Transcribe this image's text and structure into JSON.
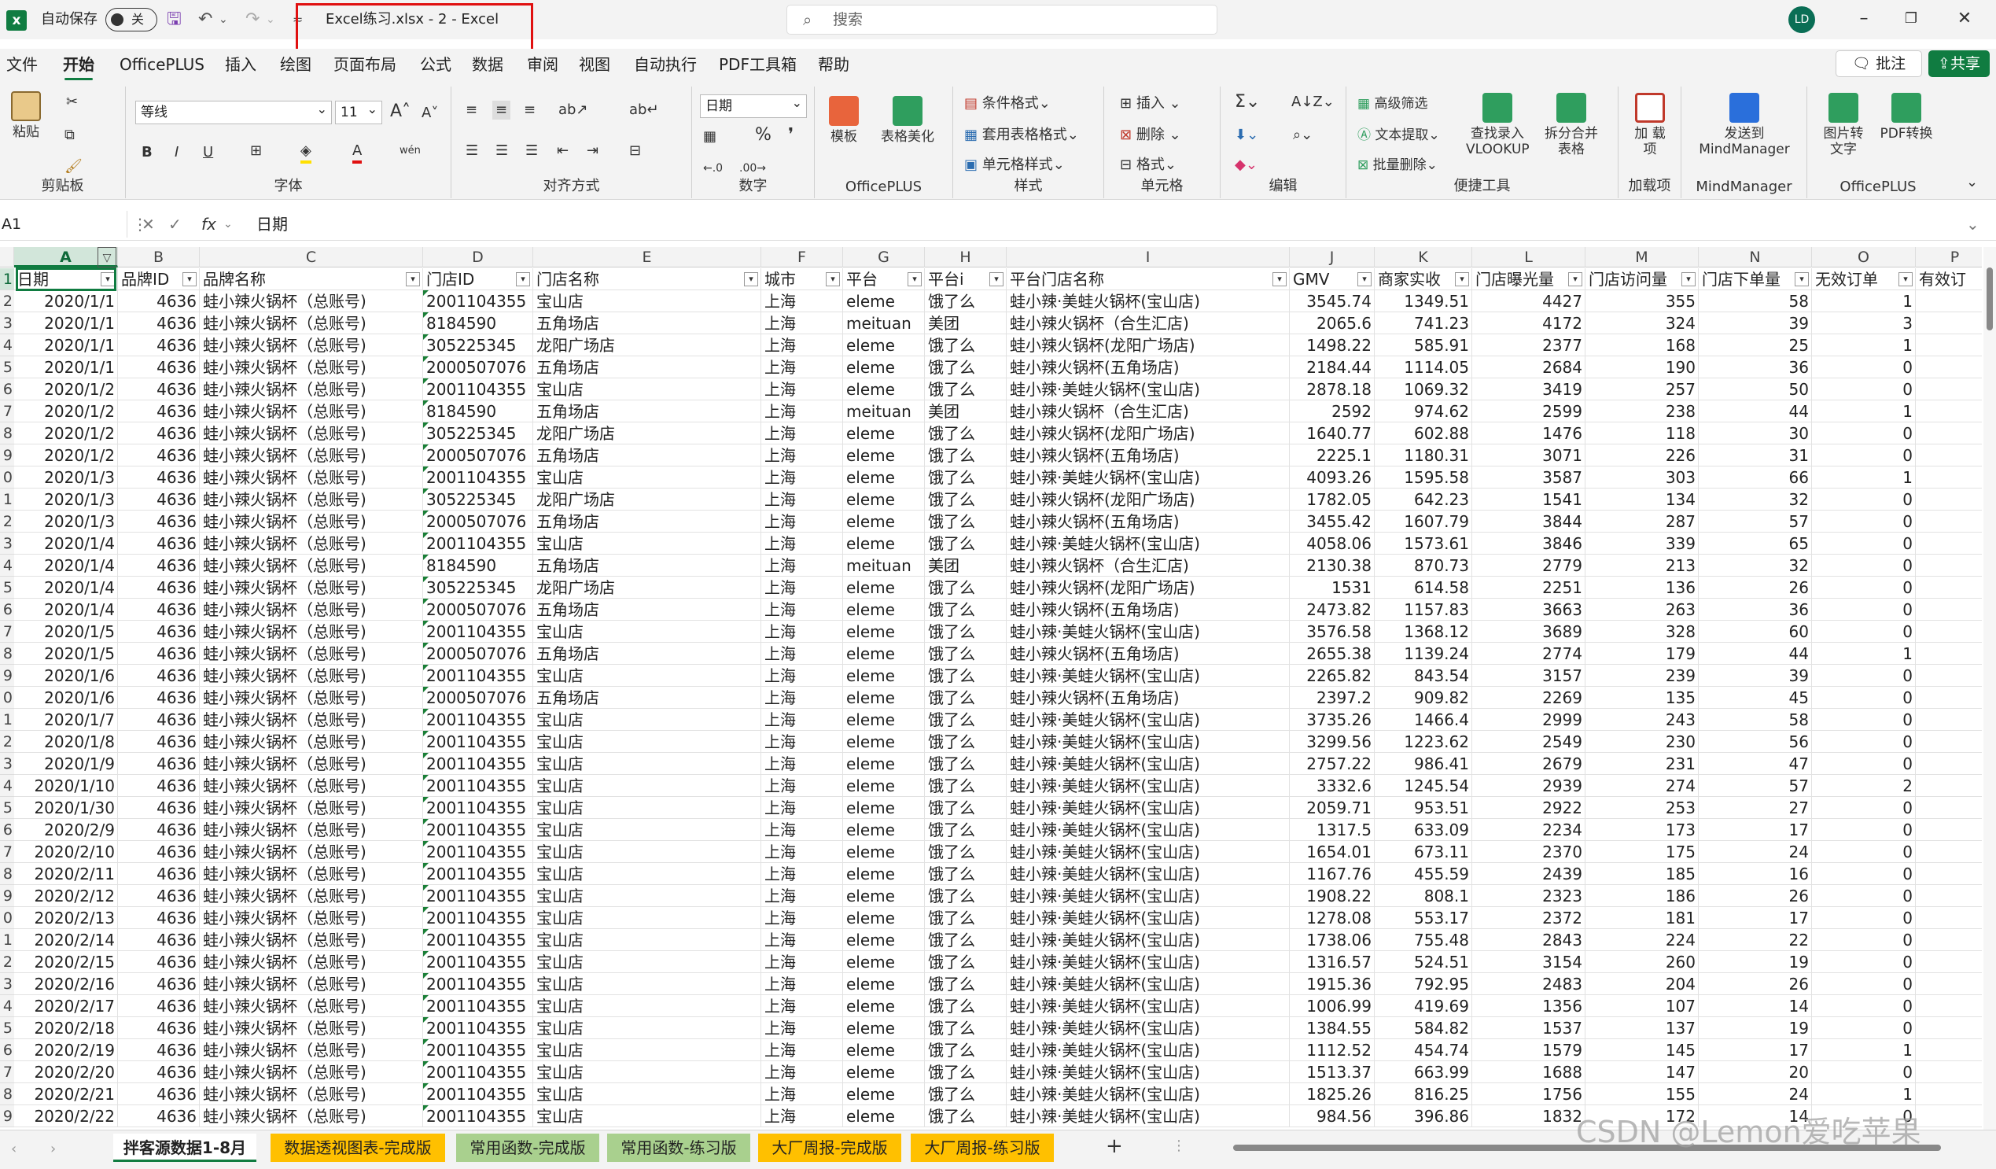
{
  "titlebar": {
    "autosave_label": "自动保存",
    "autosave_state": "关",
    "doc_title": "Excel练习.xlsx  -  2  -  Excel",
    "search_placeholder": "搜索",
    "avatar": "LD"
  },
  "menu": {
    "tabs": [
      "文件",
      "开始",
      "OfficePLUS",
      "插入",
      "绘图",
      "页面布局",
      "公式",
      "数据",
      "审阅",
      "视图",
      "自动执行",
      "PDF工具箱",
      "帮助"
    ],
    "active": "开始",
    "comment_btn": "批注",
    "share_btn": "共享"
  },
  "ribbon": {
    "clipboard": {
      "label": "剪贴板",
      "paste": "粘贴"
    },
    "font": {
      "label": "字体",
      "name": "等线",
      "size": "11"
    },
    "align": {
      "label": "对齐方式"
    },
    "number": {
      "label": "数字",
      "format": "日期"
    },
    "officeplus": {
      "label": "OfficePLUS",
      "template": "模板",
      "beautify": "表格美化"
    },
    "styles": {
      "label": "样式",
      "cond": "条件格式",
      "table": "套用表格格式",
      "cell": "单元格样式"
    },
    "cells": {
      "label": "单元格",
      "insert": "插入",
      "delete": "删除",
      "format": "格式"
    },
    "edit": {
      "label": "编辑"
    },
    "convenience": {
      "label": "便捷工具",
      "adv_filter": "高级筛选",
      "text_extract": "文本提取",
      "batch_delete": "批量删除",
      "lookup": "查找录入 VLOOKUP",
      "split": "拆分合并 表格"
    },
    "addins": {
      "label": "加载项",
      "btn": "加 载项"
    },
    "mindmanager": {
      "label": "MindManager",
      "btn": "发送到 MindManager"
    },
    "officeplus2": {
      "label": "OfficePLUS",
      "img2text": "图片转 文字",
      "pdf": "PDF转换"
    }
  },
  "formula_bar": {
    "name_box": "A1",
    "fx": "fx",
    "content": "日期"
  },
  "grid": {
    "col_letters": [
      "A",
      "B",
      "C",
      "D",
      "E",
      "F",
      "G",
      "H",
      "I",
      "J",
      "K",
      "L",
      "M",
      "N",
      "O",
      "P"
    ],
    "row_numbers": [
      "1",
      "2",
      "3",
      "4",
      "5",
      "6",
      "7",
      "8",
      "9",
      "0",
      "1",
      "2",
      "3",
      "4",
      "5",
      "6",
      "7",
      "8",
      "9",
      "0",
      "1",
      "2",
      "3",
      "4",
      "5",
      "6",
      "7",
      "8",
      "9",
      "0",
      "1",
      "2",
      "3",
      "4",
      "5",
      "6",
      "7",
      "8",
      "9"
    ],
    "headers": [
      "日期",
      "品牌ID",
      "品牌名称",
      "门店ID",
      "门店名称",
      "城市",
      "平台",
      "平台i",
      "平台门店名称",
      "GMV",
      "商家实收",
      "门店曝光量",
      "门店访问量",
      "门店下单量",
      "无效订单",
      "有效订"
    ],
    "rows": [
      [
        "2020/1/1",
        "4636",
        "蛙小辣火锅杯（总账号)",
        "2001104355",
        "宝山店",
        "上海",
        "eleme",
        "饿了么",
        "蛙小辣·美蛙火锅杯(宝山店)",
        "3545.74",
        "1349.51",
        "4427",
        "355",
        "58",
        "1"
      ],
      [
        "2020/1/1",
        "4636",
        "蛙小辣火锅杯（总账号)",
        "8184590",
        "五角场店",
        "上海",
        "meituan",
        "美团",
        "蛙小辣火锅杯（合生汇店)",
        "2065.6",
        "741.23",
        "4172",
        "324",
        "39",
        "3"
      ],
      [
        "2020/1/1",
        "4636",
        "蛙小辣火锅杯（总账号)",
        "305225345",
        "龙阳广场店",
        "上海",
        "eleme",
        "饿了么",
        "蛙小辣火锅杯(龙阳广场店)",
        "1498.22",
        "585.91",
        "2377",
        "168",
        "25",
        "1"
      ],
      [
        "2020/1/1",
        "4636",
        "蛙小辣火锅杯（总账号)",
        "2000507076",
        "五角场店",
        "上海",
        "eleme",
        "饿了么",
        "蛙小辣火锅杯(五角场店)",
        "2184.44",
        "1114.05",
        "2684",
        "190",
        "36",
        "0"
      ],
      [
        "2020/1/2",
        "4636",
        "蛙小辣火锅杯（总账号)",
        "2001104355",
        "宝山店",
        "上海",
        "eleme",
        "饿了么",
        "蛙小辣·美蛙火锅杯(宝山店)",
        "2878.18",
        "1069.32",
        "3419",
        "257",
        "50",
        "0"
      ],
      [
        "2020/1/2",
        "4636",
        "蛙小辣火锅杯（总账号)",
        "8184590",
        "五角场店",
        "上海",
        "meituan",
        "美团",
        "蛙小辣火锅杯（合生汇店)",
        "2592",
        "974.62",
        "2599",
        "238",
        "44",
        "1"
      ],
      [
        "2020/1/2",
        "4636",
        "蛙小辣火锅杯（总账号)",
        "305225345",
        "龙阳广场店",
        "上海",
        "eleme",
        "饿了么",
        "蛙小辣火锅杯(龙阳广场店)",
        "1640.77",
        "602.88",
        "1476",
        "118",
        "30",
        "0"
      ],
      [
        "2020/1/2",
        "4636",
        "蛙小辣火锅杯（总账号)",
        "2000507076",
        "五角场店",
        "上海",
        "eleme",
        "饿了么",
        "蛙小辣火锅杯(五角场店)",
        "2225.1",
        "1180.31",
        "3071",
        "226",
        "31",
        "0"
      ],
      [
        "2020/1/3",
        "4636",
        "蛙小辣火锅杯（总账号)",
        "2001104355",
        "宝山店",
        "上海",
        "eleme",
        "饿了么",
        "蛙小辣·美蛙火锅杯(宝山店)",
        "4093.26",
        "1595.58",
        "3587",
        "303",
        "66",
        "1"
      ],
      [
        "2020/1/3",
        "4636",
        "蛙小辣火锅杯（总账号)",
        "305225345",
        "龙阳广场店",
        "上海",
        "eleme",
        "饿了么",
        "蛙小辣火锅杯(龙阳广场店)",
        "1782.05",
        "642.23",
        "1541",
        "134",
        "32",
        "0"
      ],
      [
        "2020/1/3",
        "4636",
        "蛙小辣火锅杯（总账号)",
        "2000507076",
        "五角场店",
        "上海",
        "eleme",
        "饿了么",
        "蛙小辣火锅杯(五角场店)",
        "3455.42",
        "1607.79",
        "3844",
        "287",
        "57",
        "0"
      ],
      [
        "2020/1/4",
        "4636",
        "蛙小辣火锅杯（总账号)",
        "2001104355",
        "宝山店",
        "上海",
        "eleme",
        "饿了么",
        "蛙小辣·美蛙火锅杯(宝山店)",
        "4058.06",
        "1573.61",
        "3846",
        "339",
        "65",
        "0"
      ],
      [
        "2020/1/4",
        "4636",
        "蛙小辣火锅杯（总账号)",
        "8184590",
        "五角场店",
        "上海",
        "meituan",
        "美团",
        "蛙小辣火锅杯（合生汇店)",
        "2130.38",
        "870.73",
        "2779",
        "213",
        "32",
        "0"
      ],
      [
        "2020/1/4",
        "4636",
        "蛙小辣火锅杯（总账号)",
        "305225345",
        "龙阳广场店",
        "上海",
        "eleme",
        "饿了么",
        "蛙小辣火锅杯(龙阳广场店)",
        "1531",
        "614.58",
        "2251",
        "136",
        "26",
        "0"
      ],
      [
        "2020/1/4",
        "4636",
        "蛙小辣火锅杯（总账号)",
        "2000507076",
        "五角场店",
        "上海",
        "eleme",
        "饿了么",
        "蛙小辣火锅杯(五角场店)",
        "2473.82",
        "1157.83",
        "3663",
        "263",
        "36",
        "0"
      ],
      [
        "2020/1/5",
        "4636",
        "蛙小辣火锅杯（总账号)",
        "2001104355",
        "宝山店",
        "上海",
        "eleme",
        "饿了么",
        "蛙小辣·美蛙火锅杯(宝山店)",
        "3576.58",
        "1368.12",
        "3689",
        "328",
        "60",
        "0"
      ],
      [
        "2020/1/5",
        "4636",
        "蛙小辣火锅杯（总账号)",
        "2000507076",
        "五角场店",
        "上海",
        "eleme",
        "饿了么",
        "蛙小辣火锅杯(五角场店)",
        "2655.38",
        "1139.24",
        "2774",
        "179",
        "44",
        "1"
      ],
      [
        "2020/1/6",
        "4636",
        "蛙小辣火锅杯（总账号)",
        "2001104355",
        "宝山店",
        "上海",
        "eleme",
        "饿了么",
        "蛙小辣·美蛙火锅杯(宝山店)",
        "2265.82",
        "843.54",
        "3157",
        "239",
        "39",
        "0"
      ],
      [
        "2020/1/6",
        "4636",
        "蛙小辣火锅杯（总账号)",
        "2000507076",
        "五角场店",
        "上海",
        "eleme",
        "饿了么",
        "蛙小辣火锅杯(五角场店)",
        "2397.2",
        "909.82",
        "2269",
        "135",
        "45",
        "0"
      ],
      [
        "2020/1/7",
        "4636",
        "蛙小辣火锅杯（总账号)",
        "2001104355",
        "宝山店",
        "上海",
        "eleme",
        "饿了么",
        "蛙小辣·美蛙火锅杯(宝山店)",
        "3735.26",
        "1466.4",
        "2999",
        "243",
        "58",
        "0"
      ],
      [
        "2020/1/8",
        "4636",
        "蛙小辣火锅杯（总账号)",
        "2001104355",
        "宝山店",
        "上海",
        "eleme",
        "饿了么",
        "蛙小辣·美蛙火锅杯(宝山店)",
        "3299.56",
        "1223.62",
        "2549",
        "230",
        "56",
        "0"
      ],
      [
        "2020/1/9",
        "4636",
        "蛙小辣火锅杯（总账号)",
        "2001104355",
        "宝山店",
        "上海",
        "eleme",
        "饿了么",
        "蛙小辣·美蛙火锅杯(宝山店)",
        "2757.22",
        "986.41",
        "2679",
        "231",
        "47",
        "0"
      ],
      [
        "2020/1/10",
        "4636",
        "蛙小辣火锅杯（总账号)",
        "2001104355",
        "宝山店",
        "上海",
        "eleme",
        "饿了么",
        "蛙小辣·美蛙火锅杯(宝山店)",
        "3332.6",
        "1245.54",
        "2939",
        "274",
        "57",
        "2"
      ],
      [
        "2020/1/30",
        "4636",
        "蛙小辣火锅杯（总账号)",
        "2001104355",
        "宝山店",
        "上海",
        "eleme",
        "饿了么",
        "蛙小辣·美蛙火锅杯(宝山店)",
        "2059.71",
        "953.51",
        "2922",
        "253",
        "27",
        "0"
      ],
      [
        "2020/2/9",
        "4636",
        "蛙小辣火锅杯（总账号)",
        "2001104355",
        "宝山店",
        "上海",
        "eleme",
        "饿了么",
        "蛙小辣·美蛙火锅杯(宝山店)",
        "1317.5",
        "633.09",
        "2234",
        "173",
        "17",
        "0"
      ],
      [
        "2020/2/10",
        "4636",
        "蛙小辣火锅杯（总账号)",
        "2001104355",
        "宝山店",
        "上海",
        "eleme",
        "饿了么",
        "蛙小辣·美蛙火锅杯(宝山店)",
        "1654.01",
        "673.11",
        "2370",
        "175",
        "24",
        "0"
      ],
      [
        "2020/2/11",
        "4636",
        "蛙小辣火锅杯（总账号)",
        "2001104355",
        "宝山店",
        "上海",
        "eleme",
        "饿了么",
        "蛙小辣·美蛙火锅杯(宝山店)",
        "1167.76",
        "455.59",
        "2439",
        "185",
        "16",
        "0"
      ],
      [
        "2020/2/12",
        "4636",
        "蛙小辣火锅杯（总账号)",
        "2001104355",
        "宝山店",
        "上海",
        "eleme",
        "饿了么",
        "蛙小辣·美蛙火锅杯(宝山店)",
        "1908.22",
        "808.1",
        "2323",
        "186",
        "26",
        "0"
      ],
      [
        "2020/2/13",
        "4636",
        "蛙小辣火锅杯（总账号)",
        "2001104355",
        "宝山店",
        "上海",
        "eleme",
        "饿了么",
        "蛙小辣·美蛙火锅杯(宝山店)",
        "1278.08",
        "553.17",
        "2372",
        "181",
        "17",
        "0"
      ],
      [
        "2020/2/14",
        "4636",
        "蛙小辣火锅杯（总账号)",
        "2001104355",
        "宝山店",
        "上海",
        "eleme",
        "饿了么",
        "蛙小辣·美蛙火锅杯(宝山店)",
        "1738.06",
        "755.48",
        "2843",
        "224",
        "22",
        "0"
      ],
      [
        "2020/2/15",
        "4636",
        "蛙小辣火锅杯（总账号)",
        "2001104355",
        "宝山店",
        "上海",
        "eleme",
        "饿了么",
        "蛙小辣·美蛙火锅杯(宝山店)",
        "1316.57",
        "524.51",
        "3154",
        "260",
        "19",
        "0"
      ],
      [
        "2020/2/16",
        "4636",
        "蛙小辣火锅杯（总账号)",
        "2001104355",
        "宝山店",
        "上海",
        "eleme",
        "饿了么",
        "蛙小辣·美蛙火锅杯(宝山店)",
        "1915.36",
        "792.95",
        "2483",
        "204",
        "26",
        "0"
      ],
      [
        "2020/2/17",
        "4636",
        "蛙小辣火锅杯（总账号)",
        "2001104355",
        "宝山店",
        "上海",
        "eleme",
        "饿了么",
        "蛙小辣·美蛙火锅杯(宝山店)",
        "1006.99",
        "419.69",
        "1356",
        "107",
        "14",
        "0"
      ],
      [
        "2020/2/18",
        "4636",
        "蛙小辣火锅杯（总账号)",
        "2001104355",
        "宝山店",
        "上海",
        "eleme",
        "饿了么",
        "蛙小辣·美蛙火锅杯(宝山店)",
        "1384.55",
        "584.82",
        "1537",
        "137",
        "19",
        "0"
      ],
      [
        "2020/2/19",
        "4636",
        "蛙小辣火锅杯（总账号)",
        "2001104355",
        "宝山店",
        "上海",
        "eleme",
        "饿了么",
        "蛙小辣·美蛙火锅杯(宝山店)",
        "1112.52",
        "454.74",
        "1579",
        "145",
        "17",
        "1"
      ],
      [
        "2020/2/20",
        "4636",
        "蛙小辣火锅杯（总账号)",
        "2001104355",
        "宝山店",
        "上海",
        "eleme",
        "饿了么",
        "蛙小辣·美蛙火锅杯(宝山店)",
        "1513.37",
        "663.99",
        "1688",
        "147",
        "20",
        "0"
      ],
      [
        "2020/2/21",
        "4636",
        "蛙小辣火锅杯（总账号)",
        "2001104355",
        "宝山店",
        "上海",
        "eleme",
        "饿了么",
        "蛙小辣·美蛙火锅杯(宝山店)",
        "1825.26",
        "816.25",
        "1756",
        "155",
        "24",
        "1"
      ],
      [
        "2020/2/22",
        "4636",
        "蛙小辣火锅杯（总账号)",
        "2001104355",
        "宝山店",
        "上海",
        "eleme",
        "饿了么",
        "蛙小辣·美蛙火锅杯(宝山店)",
        "984.56",
        "396.86",
        "1832",
        "172",
        "14",
        "0"
      ]
    ]
  },
  "sheets": {
    "tabs": [
      {
        "label": "拌客源数据1-8月",
        "style": "on"
      },
      {
        "label": "数据透视图表-完成版",
        "style": "y"
      },
      {
        "label": "常用函数-完成版",
        "style": "g"
      },
      {
        "label": "常用函数-练习版",
        "style": "g"
      },
      {
        "label": "大厂周报-完成版",
        "style": "y"
      },
      {
        "label": "大厂周报-练习版",
        "style": "y"
      }
    ],
    "add": "+"
  },
  "watermark": "CSDN @Lemon爱吃苹果",
  "colors": {
    "excel_green": "#107c41",
    "highlight_red": "#e01010",
    "tab_yellow": "#ffc000",
    "tab_green": "#a9d08e"
  }
}
